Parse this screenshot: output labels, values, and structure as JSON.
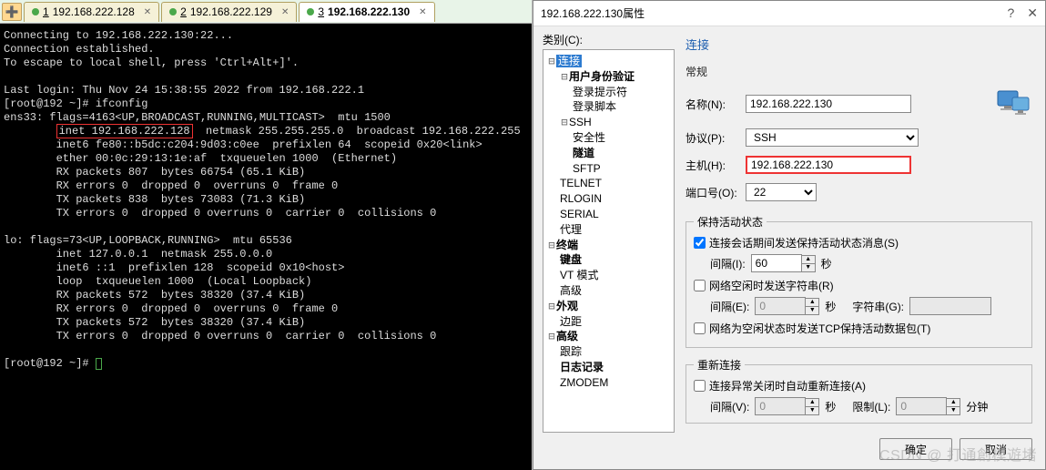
{
  "tabs": {
    "t0": {
      "num": "1",
      "label": "192.168.222.128"
    },
    "t1": {
      "num": "2",
      "label": "192.168.222.129"
    },
    "t2": {
      "num": "3",
      "label": "192.168.222.130"
    }
  },
  "terminal": {
    "block1": "Connecting to 192.168.222.130:22...\nConnection established.\nTo escape to local shell, press 'Ctrl+Alt+]'.\n\nLast login: Thu Nov 24 15:38:55 2022 from 192.168.222.1\n[root@192 ~]# ifconfig\nens33: flags=4163<UP,BROADCAST,RUNNING,MULTICAST>  mtu 1500",
    "hl_prefix": "        ",
    "hl_text": "inet 192.168.222.128",
    "hl_suffix": "  netmask 255.255.255.0  broadcast 192.168.222.255",
    "block2": "        inet6 fe80::b5dc:c204:9d03:c0ee  prefixlen 64  scopeid 0x20<link>\n        ether 00:0c:29:13:1e:af  txqueuelen 1000  (Ethernet)\n        RX packets 807  bytes 66754 (65.1 KiB)\n        RX errors 0  dropped 0  overruns 0  frame 0\n        TX packets 838  bytes 73083 (71.3 KiB)\n        TX errors 0  dropped 0 overruns 0  carrier 0  collisions 0\n\nlo: flags=73<UP,LOOPBACK,RUNNING>  mtu 65536\n        inet 127.0.0.1  netmask 255.0.0.0\n        inet6 ::1  prefixlen 128  scopeid 0x10<host>\n        loop  txqueuelen 1000  (Local Loopback)\n        RX packets 572  bytes 38320 (37.4 KiB)\n        RX errors 0  dropped 0  overruns 0  frame 0\n        TX packets 572  bytes 38320 (37.4 KiB)\n        TX errors 0  dropped 0 overruns 0  carrier 0  collisions 0\n",
    "prompt": "[root@192 ~]# "
  },
  "dialog": {
    "title": "192.168.222.130属性",
    "help": "?",
    "close": "✕",
    "category_label": "类别(C):",
    "tree": {
      "connection": "连接",
      "user_auth": "用户身份验证",
      "login_prompt": "登录提示符",
      "login_script": "登录脚本",
      "ssh": "SSH",
      "security": "安全性",
      "tunnel": "隧道",
      "sftp": "SFTP",
      "telnet": "TELNET",
      "rlogin": "RLOGIN",
      "serial": "SERIAL",
      "proxy": "代理",
      "terminal": "终端",
      "keyboard": "键盘",
      "vt_mode": "VT 模式",
      "advanced_term": "高级",
      "appearance": "外观",
      "margin": "边距",
      "advanced": "高级",
      "trace": "跟踪",
      "logging": "日志记录",
      "zmodem": "ZMODEM"
    },
    "form": {
      "heading": "连接",
      "general": "常规",
      "name_label": "名称(N):",
      "name_value": "192.168.222.130",
      "protocol_label": "协议(P):",
      "protocol_value": "SSH",
      "host_label": "主机(H):",
      "host_value": "192.168.222.130",
      "port_label": "端口号(O):",
      "port_value": "22"
    },
    "keepalive": {
      "legend": "保持活动状态",
      "send_msg": "连接会话期间发送保持活动状态消息(S)",
      "interval_i": "间隔(I):",
      "interval_i_val": "60",
      "sec": "秒",
      "idle_send": "网络空闲时发送字符串(R)",
      "interval_e": "间隔(E):",
      "interval_e_val": "0",
      "string_label": "字符串(G):",
      "string_val": "",
      "tcp_keepalive": "网络为空闲状态时发送TCP保持活动数据包(T)"
    },
    "reconnect": {
      "legend": "重新连接",
      "auto_reconnect": "连接异常关闭时自动重新连接(A)",
      "interval_v": "间隔(V):",
      "interval_v_val": "0",
      "sec": "秒",
      "limit_label": "限制(L):",
      "limit_val": "0",
      "min": "分钟"
    },
    "buttons": {
      "ok": "确定",
      "cancel": "取消"
    }
  },
  "watermark": "CSDN @ 打通創模遊堵"
}
